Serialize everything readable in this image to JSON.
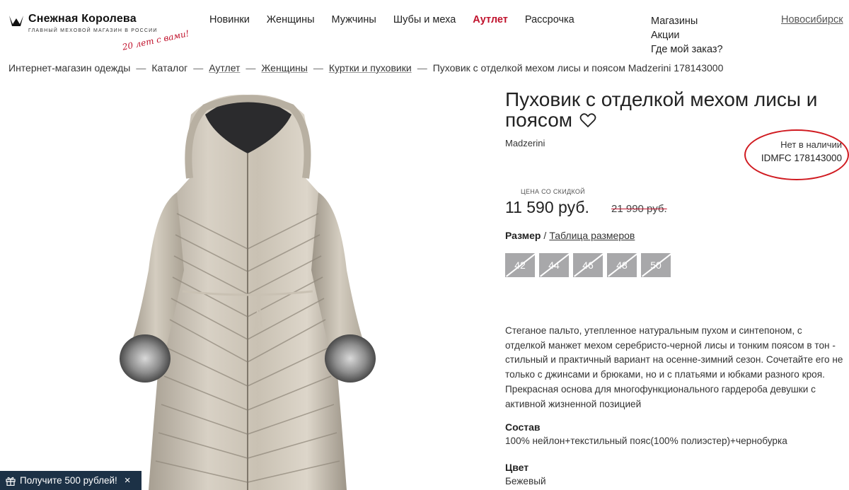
{
  "brand": {
    "name": "Снежная Королева",
    "tagline": "ГЛАВНЫЙ МЕХОВОЙ МАГАЗИН В РОССИИ",
    "promo": "20 лет с вами!"
  },
  "nav": {
    "items": [
      "Новинки",
      "Женщины",
      "Мужчины",
      "Шубы и меха",
      "Аутлет",
      "Рассрочка"
    ]
  },
  "right_links": [
    "Магазины",
    "Акции",
    "Где мой заказ?"
  ],
  "city": "Новосибирск",
  "breadcrumb": [
    "Интернет-магазин одежды",
    "Каталог",
    "Аутлет",
    "Женщины",
    "Куртки и пуховики",
    "Пуховик с отделкой мехом лисы и поясом Madzerini 178143000"
  ],
  "product": {
    "title": "Пуховик с отделкой мехом лисы и поясом",
    "brand": "Madzerini",
    "availability": "Нет в наличии",
    "sku": "IDMFC 178143000",
    "price_label": "ЦЕНА СО СКИДКОЙ",
    "price": "11 590 руб.",
    "old_price": "21 990 руб.",
    "size_label": "Размер",
    "size_table": "Таблица размеров",
    "sizes": [
      "42",
      "44",
      "46",
      "48",
      "50"
    ],
    "description": "Стеганое пальто, утепленное натуральным пухом и синтепоном, с отделкой манжет мехом серебристо-черной лисы и тонким поясом в тон - стильный и практичный вариант на осенне-зимний сезон. Сочетайте его не только с джинсами и брюками, но и с платьями и юбками разного кроя. Прекрасная основа для многофункционального гардероба девушки с активной жизненной позицией",
    "composition_label": "Состав",
    "composition": "100% нейлон+текстильный пояс(100% полиэстер)+чернобурка",
    "color_label": "Цвет",
    "color": "Бежевый"
  },
  "promo_bar": {
    "text": "Получите 500 рублей!",
    "close": "×"
  },
  "colors": {
    "accent": "#c0122c",
    "size_chip": "#a8a8aa",
    "promo_bg": "#1c3146",
    "annotation": "#d01a20"
  }
}
